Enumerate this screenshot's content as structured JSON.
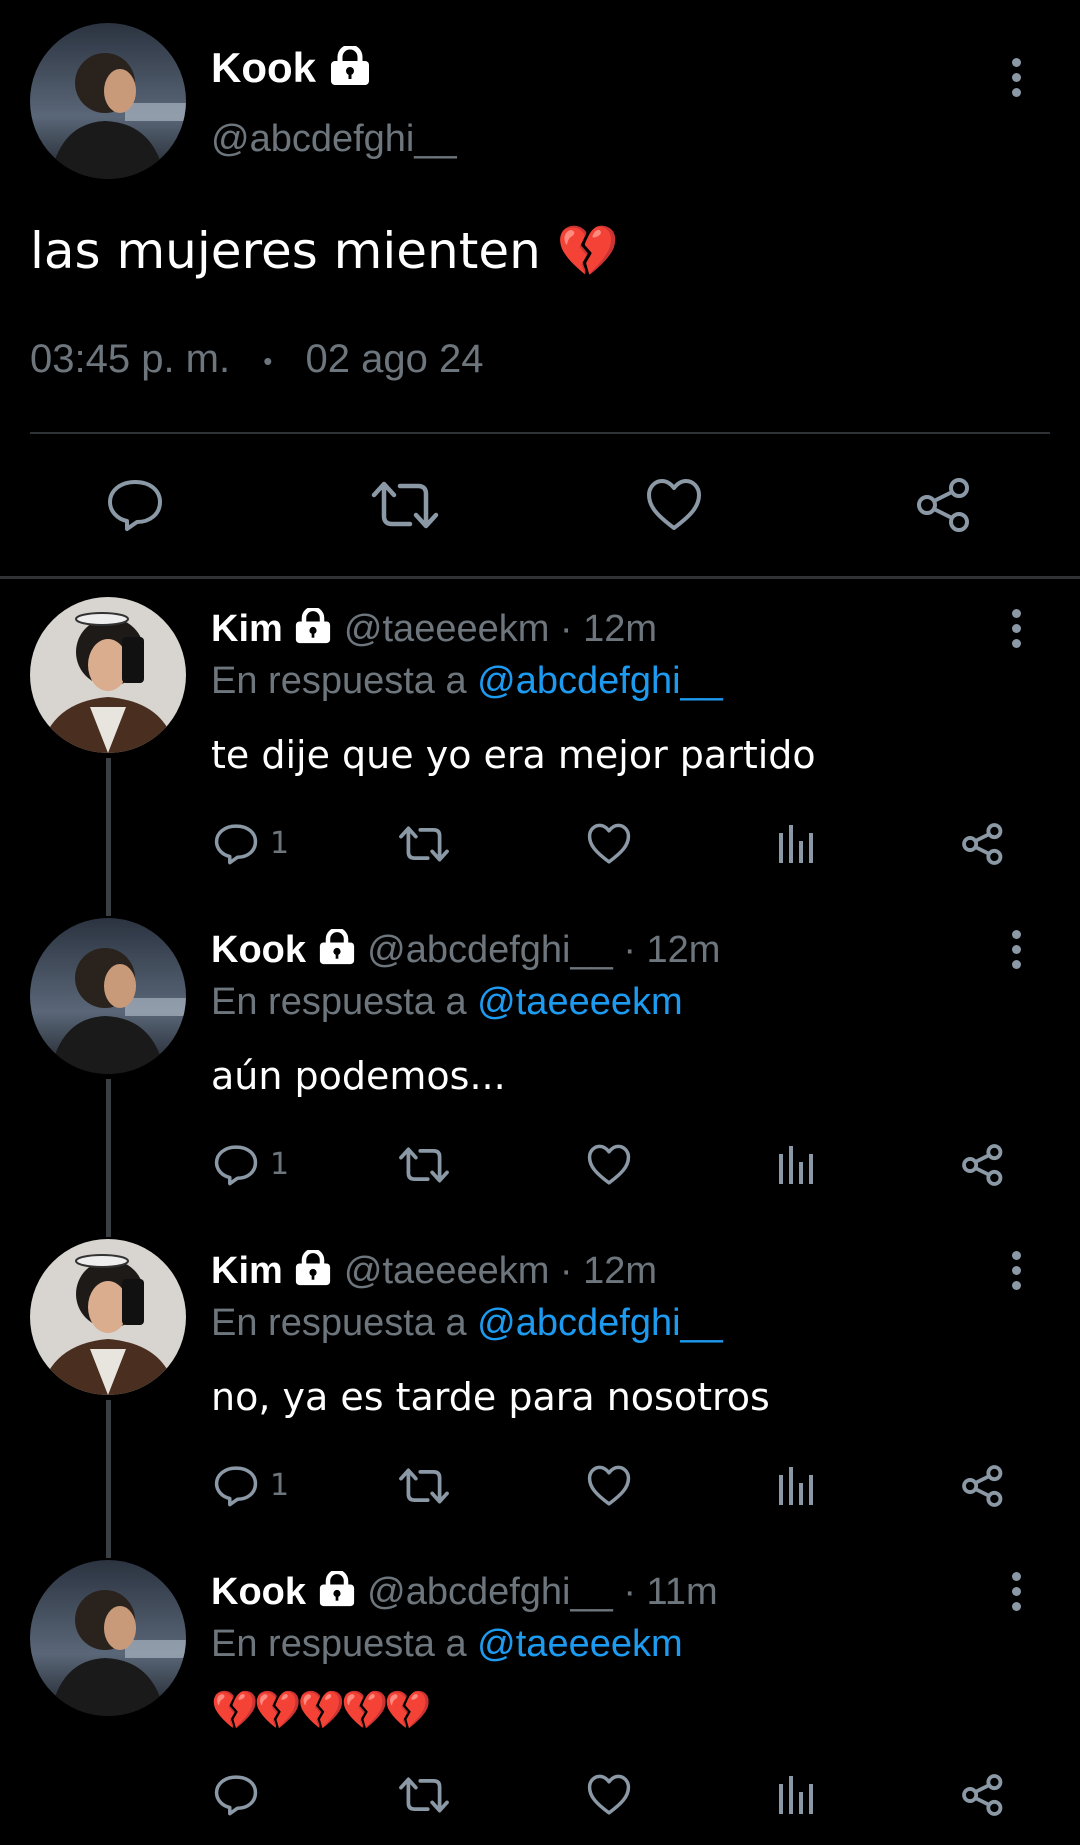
{
  "main_tweet": {
    "name": "Kook",
    "handle": "@abcdefghi__",
    "text": "las mujeres mienten 💔",
    "time": "03:45 p. m.",
    "separator": "•",
    "date": "02 ago 24"
  },
  "replies": [
    {
      "name": "Kim",
      "handle": "@taeeeekm · 12m",
      "reply_prefix": "En respuesta a",
      "reply_to": "@abcdefghi__",
      "text": "te dije que yo era mejor partido",
      "reply_count": "1"
    },
    {
      "name": "Kook",
      "handle": "@abcdefghi__ · 12m",
      "reply_prefix": "En respuesta a",
      "reply_to": "@taeeeekm",
      "text": "aún podemos...",
      "reply_count": "1"
    },
    {
      "name": "Kim",
      "handle": "@taeeeekm · 12m",
      "reply_prefix": "En respuesta a",
      "reply_to": "@abcdefghi__",
      "text": "no, ya es tarde para nosotros",
      "reply_count": "1"
    },
    {
      "name": "Kook",
      "handle": "@abcdefghi__ · 11m",
      "reply_prefix": "En respuesta a",
      "reply_to": "@taeeeekm",
      "text": "💔💔💔💔💔",
      "reply_count": ""
    }
  ],
  "colors": {
    "background": "#000000",
    "secondary_text": "#6e767d",
    "link": "#1d9bf0",
    "icon": "#8b98a5"
  },
  "icons": [
    "lock-icon",
    "more-options-icon",
    "reply-icon",
    "retweet-icon",
    "like-icon",
    "share-icon",
    "views-icon"
  ]
}
